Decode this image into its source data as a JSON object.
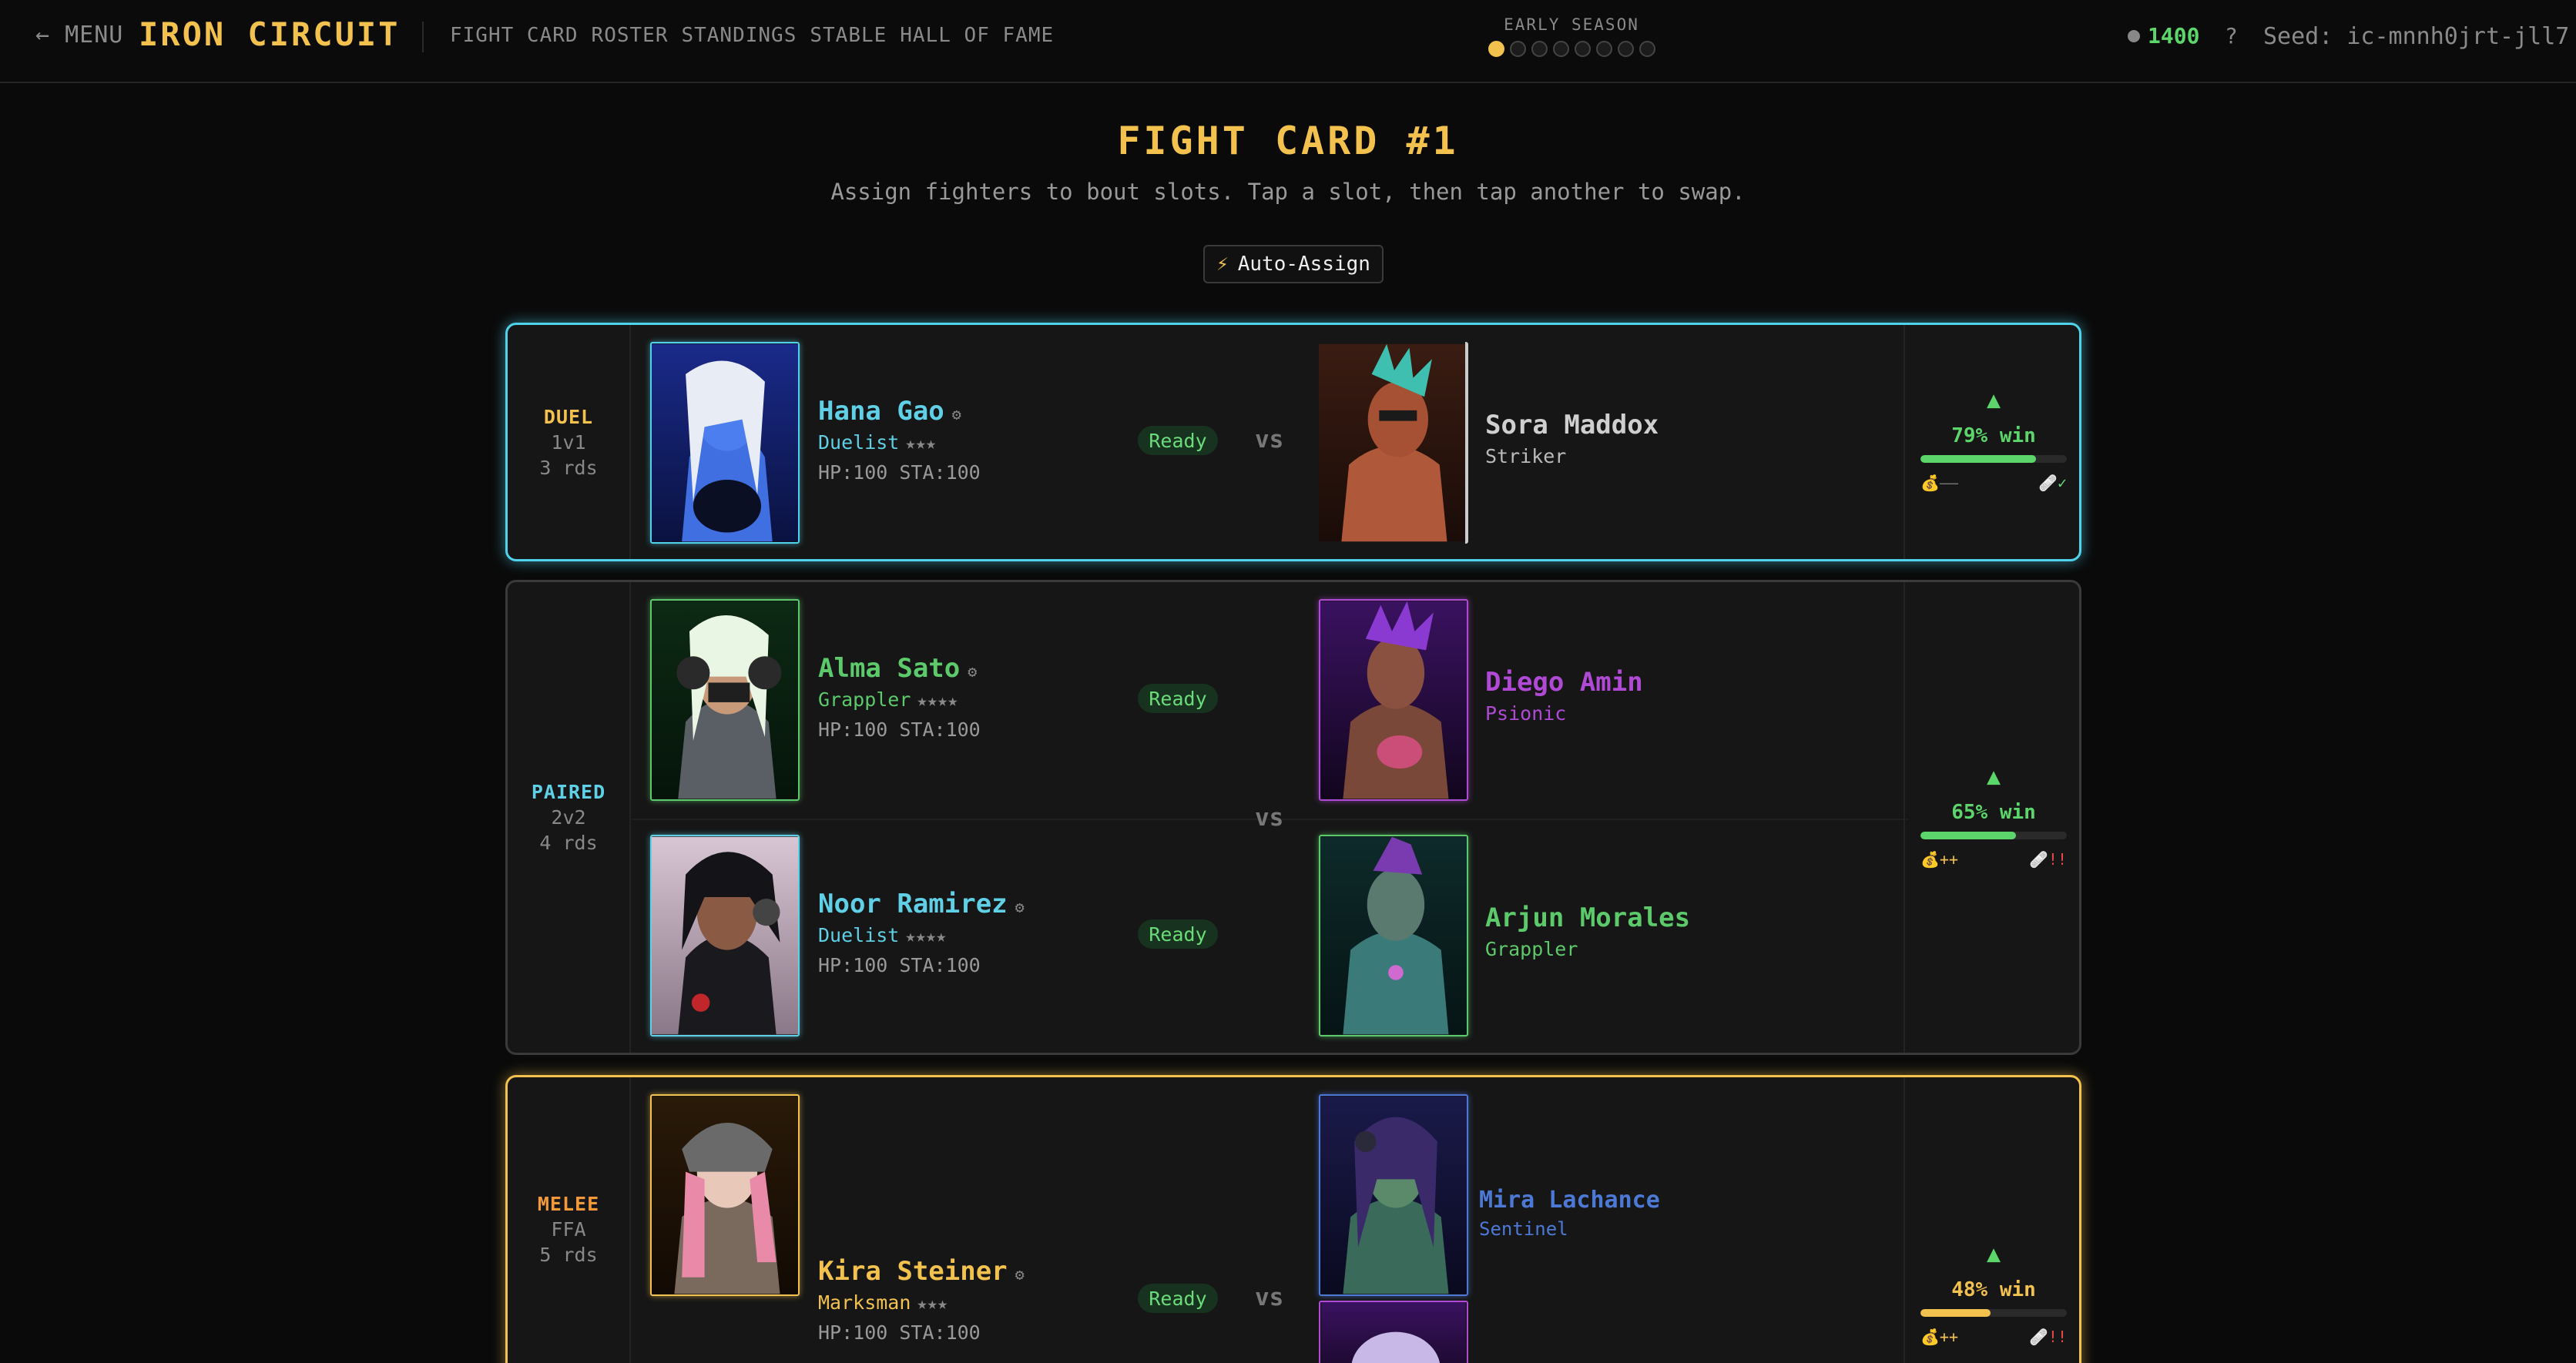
{
  "header": {
    "menu_label": "← MENU",
    "brand": "IRON CIRCUIT",
    "nav": [
      "FIGHT CARD",
      "ROSTER",
      "STANDINGS",
      "STABLE",
      "HALL OF FAME"
    ],
    "season_label": "EARLY SEASON",
    "season_progress": {
      "current": 1,
      "total": 8
    },
    "money": "1400",
    "help": "?",
    "seed": "Seed: ic-mnnh0jrt-jll7"
  },
  "page": {
    "title": "FIGHT CARD #1",
    "subtitle": "Assign fighters to bout slots. Tap a slot, then tap another to swap.",
    "auto_assign_label": "Auto-Assign",
    "auto_assign_icon": "lightning-bolt-icon"
  },
  "colors": {
    "accent_gold": "#f2c14e",
    "duel_cyan": "#4fd2ea",
    "win_green": "#5cd66a",
    "role_duelist": "#5fd0e6",
    "role_grappler": "#5cc96a",
    "role_psionic": "#b04ad6",
    "role_marksman": "#f2c14e",
    "role_sentinel": "#4d79d6"
  },
  "bouts": [
    {
      "type": "DUEL",
      "format": "1v1",
      "rounds": "3 rds",
      "left": [
        {
          "name": "Hana Gao",
          "role": "Duelist",
          "stars": "★★★",
          "stats": "HP:100  STA:100",
          "status": "Ready"
        }
      ],
      "vs": "vs",
      "right": [
        {
          "name": "Sora Maddox",
          "role": "Striker"
        }
      ],
      "win": {
        "trend_icon": "triangle-up-icon",
        "percent": 79,
        "label": "79% win",
        "mod_left": "💰——",
        "mod_right": "🩹✓"
      }
    },
    {
      "type": "PAIRED",
      "format": "2v2",
      "rounds": "4 rds",
      "left": [
        {
          "name": "Alma Sato",
          "role": "Grappler",
          "stars": "★★★★",
          "stats": "HP:100  STA:100",
          "status": "Ready"
        },
        {
          "name": "Noor Ramirez",
          "role": "Duelist",
          "stars": "★★★★",
          "stats": "HP:100  STA:100",
          "status": "Ready"
        }
      ],
      "vs": "vs",
      "right": [
        {
          "name": "Diego Amin",
          "role": "Psionic"
        },
        {
          "name": "Arjun Morales",
          "role": "Grappler"
        }
      ],
      "win": {
        "trend_icon": "triangle-up-icon",
        "percent": 65,
        "label": "65% win",
        "mod_left": "💰++",
        "mod_right": "🩹!!"
      }
    },
    {
      "type": "MELEE",
      "format": "FFA",
      "rounds": "5 rds",
      "left": [
        {
          "name": "Kira Steiner",
          "role": "Marksman",
          "stars": "★★★",
          "stats": "HP:100  STA:100",
          "status": "Ready"
        }
      ],
      "vs": "vs",
      "right": [
        {
          "name": "Mira Lachance",
          "role": "Sentinel"
        }
      ],
      "win": {
        "trend_icon": "triangle-up-icon",
        "percent": 48,
        "label": "48% win",
        "mod_left": "💰++",
        "mod_right": "🩹!!"
      }
    }
  ]
}
